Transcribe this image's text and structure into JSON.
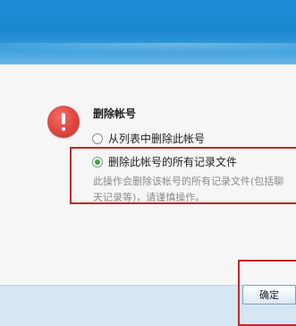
{
  "dialog": {
    "title": "删除帐号",
    "options": [
      {
        "label": "从列表中删除此帐号",
        "selected": false
      },
      {
        "label": "删除此帐号的所有记录文件",
        "selected": true
      }
    ],
    "description": "此操作会删除该帐号的所有记录文件(包括聊天记录等)，请谨慎操作。",
    "buttons": {
      "ok_label": "确定"
    },
    "icon": "error-icon"
  },
  "colors": {
    "titlebar_blue": "#1a86cf",
    "footer_bg": "#d7e6f3",
    "highlight_red": "#c0272b",
    "radio_green": "#3aa14a",
    "error_red": "#e24a44"
  }
}
